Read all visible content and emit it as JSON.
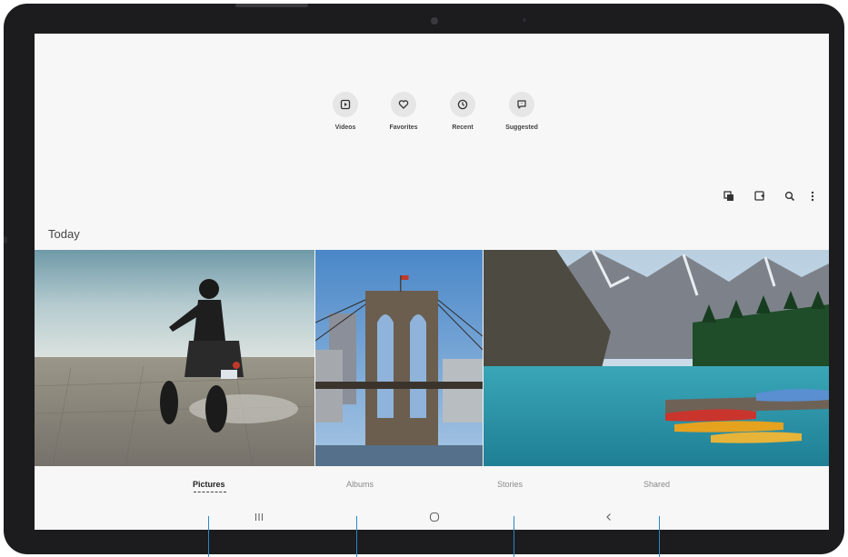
{
  "quick_access": [
    {
      "label": "Videos",
      "icon": "play-square-icon"
    },
    {
      "label": "Favorites",
      "icon": "heart-icon"
    },
    {
      "label": "Recent",
      "icon": "clock-icon"
    },
    {
      "label": "Suggested",
      "icon": "suggestion-bubble-icon"
    }
  ],
  "toolbar": {
    "icons": [
      "select-icon",
      "add-photo-icon",
      "search-icon",
      "more-options-icon"
    ]
  },
  "section": {
    "title": "Today"
  },
  "tabs": [
    {
      "label": "Pictures",
      "active": true
    },
    {
      "label": "Albums",
      "active": false
    },
    {
      "label": "Stories",
      "active": false
    },
    {
      "label": "Shared",
      "active": false
    }
  ],
  "navbar": {
    "icons": [
      "recent-apps-icon",
      "home-icon",
      "back-icon"
    ]
  },
  "colors": {
    "callout": "#2a86c8",
    "frame": "#1c1c1e",
    "screen_bg": "#f7f7f7"
  }
}
